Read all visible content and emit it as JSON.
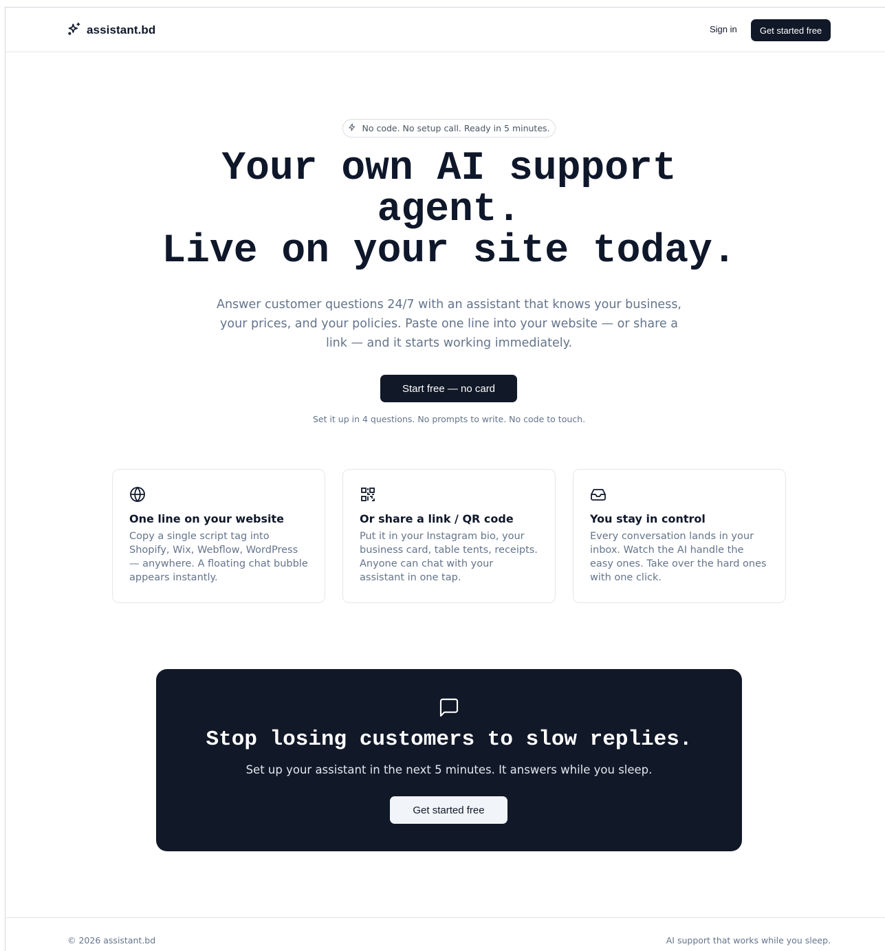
{
  "header": {
    "logo_text": "assistant.bd",
    "logo_icon": "sparkles-icon",
    "signin_label": "Sign in",
    "cta_label": "Get started free"
  },
  "hero": {
    "pill_icon": "zap-icon",
    "pill_text": "No code. No setup call. Ready in 5 minutes.",
    "title_line1": "Your own AI support",
    "title_line2": "agent.",
    "title_line3": "Live on your site today.",
    "subtitle": "Answer customer questions 24/7 with an assistant that knows your business, your prices, and your policies. Paste one line into your website — or share a link — and it starts working immediately.",
    "primary_button": "Start free — no card",
    "note": "Set it up in 4 questions. No prompts to write. No code to touch."
  },
  "features": [
    {
      "icon": "globe-icon",
      "title": "One line on your website",
      "body": "Copy a single script tag into Shopify, Wix, Webflow, WordPress — anywhere. A floating chat bubble appears instantly."
    },
    {
      "icon": "qr-code-icon",
      "title": "Or share a link / QR code",
      "body": "Put it in your Instagram bio, your business card, table tents, receipts. Anyone can chat with your assistant in one tap."
    },
    {
      "icon": "inbox-icon",
      "title": "You stay in control",
      "body": "Every conversation lands in your inbox. Watch the AI handle the easy ones. Take over the hard ones with one click."
    }
  ],
  "cta": {
    "icon": "message-square-icon",
    "title": "Stop losing customers to slow replies.",
    "subtitle": "Set up your assistant in the next 5 minutes. It answers while you sleep.",
    "button": "Get started free"
  },
  "footer": {
    "copyright": "© 2026 assistant.bd",
    "tagline": "AI support that works while you sleep."
  },
  "colors": {
    "primary_dark": "#111827",
    "muted_text": "#64748b",
    "border": "#e5e7eb"
  }
}
